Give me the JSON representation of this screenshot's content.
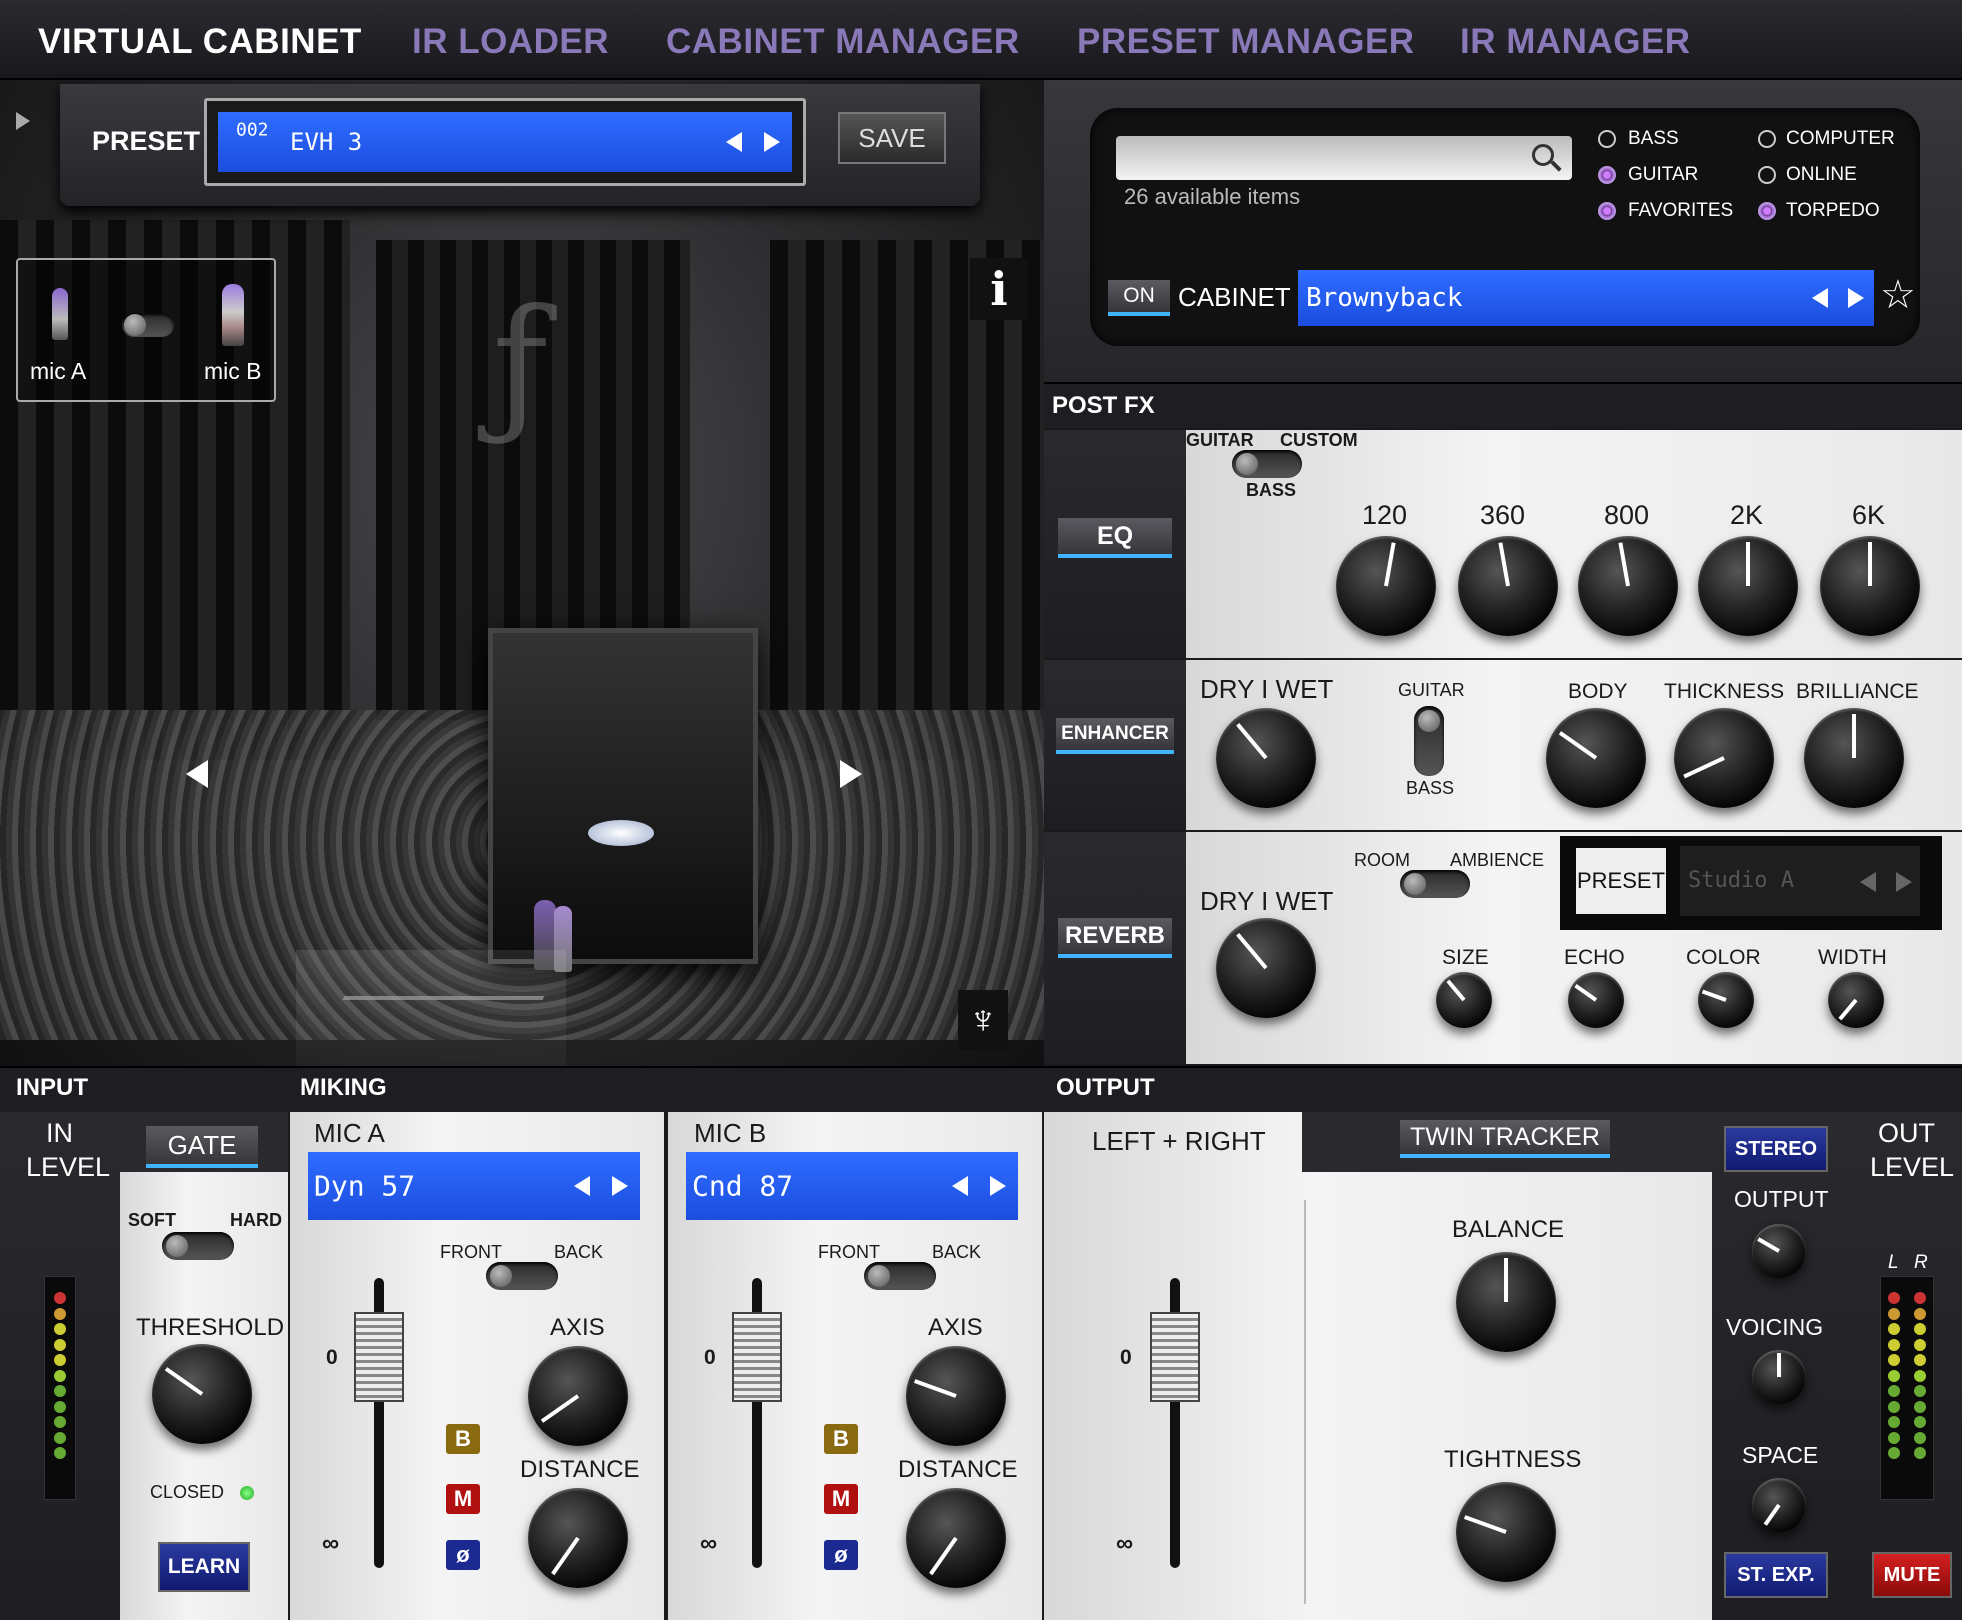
{
  "nav": {
    "tabs": [
      {
        "label": "VIRTUAL CABINET"
      },
      {
        "label": "IR LOADER"
      },
      {
        "label": "CABINET MANAGER"
      },
      {
        "label": "PRESET MANAGER"
      },
      {
        "label": "IR MANAGER"
      }
    ]
  },
  "preset": {
    "label": "PRESET",
    "number": "002",
    "name": "EVH 3",
    "save": "SAVE"
  },
  "room": {
    "mic_a": "mic A",
    "mic_b": "mic B",
    "info": "i"
  },
  "browser": {
    "available": "26 available items",
    "filters": [
      {
        "label": "BASS",
        "on": false
      },
      {
        "label": "COMPUTER",
        "on": false
      },
      {
        "label": "GUITAR",
        "on": true
      },
      {
        "label": "ONLINE",
        "on": false
      },
      {
        "label": "FAVORITES",
        "on": true
      },
      {
        "label": "TORPEDO",
        "on": true
      }
    ],
    "on_label": "ON",
    "cabinet_label": "CABINET",
    "cabinet_name": "Brownyback"
  },
  "postfx": {
    "title": "POST FX",
    "eq": {
      "button": "EQ",
      "guitar": "GUITAR",
      "custom": "CUSTOM",
      "bass": "BASS",
      "bands": [
        "120",
        "360",
        "800",
        "2K",
        "6K"
      ]
    },
    "enhancer": {
      "button": "ENHANCER",
      "drywet": "DRY I WET",
      "guitar": "GUITAR",
      "bass": "BASS",
      "body": "BODY",
      "thickness": "THICKNESS",
      "brilliance": "BRILLIANCE"
    },
    "reverb": {
      "button": "REVERB",
      "drywet": "DRY I WET",
      "room": "ROOM",
      "ambience": "AMBIENCE",
      "preset": "PRESET",
      "preset_name": "Studio A",
      "size": "SIZE",
      "echo": "ECHO",
      "color": "COLOR",
      "width": "WIDTH"
    }
  },
  "input": {
    "title": "INPUT",
    "in": "IN",
    "level": "LEVEL",
    "gate": "GATE",
    "soft": "SOFT",
    "hard": "HARD",
    "threshold": "THRESHOLD",
    "closed": "CLOSED",
    "learn": "LEARN"
  },
  "miking": {
    "title": "MIKING",
    "mic_a": {
      "title": "MIC A",
      "name": "Dyn 57",
      "front": "FRONT",
      "back": "BACK",
      "axis": "AXIS",
      "distance": "DISTANCE",
      "b": "B",
      "m": "M",
      "phase": "ø",
      "zero": "0"
    },
    "mic_b": {
      "title": "MIC B",
      "name": "Cnd 87",
      "front": "FRONT",
      "back": "BACK",
      "axis": "AXIS",
      "distance": "DISTANCE",
      "b": "B",
      "m": "M",
      "phase": "ø",
      "zero": "0"
    }
  },
  "output": {
    "title": "OUTPUT",
    "left_right": "LEFT + RIGHT",
    "twin_tracker": "TWIN TRACKER",
    "balance": "BALANCE",
    "tightness": "TIGHTNESS",
    "zero": "0",
    "stereo": "STEREO",
    "output": "OUTPUT",
    "voicing": "VOICING",
    "space": "SPACE",
    "st_exp": "ST. EXP.",
    "mute": "MUTE",
    "out": "OUT",
    "level": "LEVEL",
    "l": "L",
    "r": "R"
  }
}
